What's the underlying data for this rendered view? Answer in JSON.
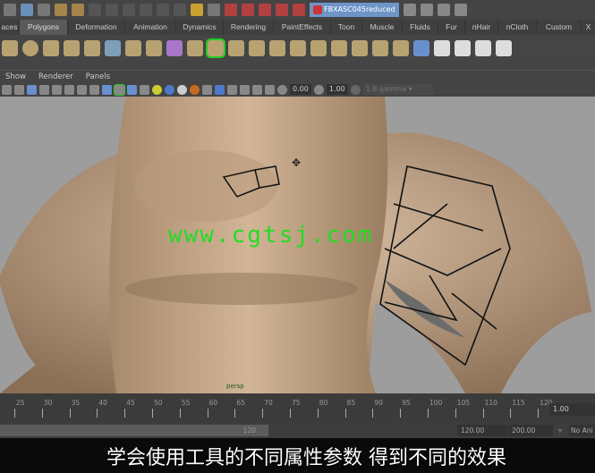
{
  "status_line": {
    "scene_field": "FBXASC045reduced"
  },
  "shelf": {
    "tabs": [
      "aces",
      "Polygons",
      "Deformation",
      "Animation",
      "Dynamics",
      "Rendering",
      "PaintEffects",
      "Toon",
      "Muscle",
      "Fluids",
      "Fur",
      "nHair",
      "nCloth",
      "Custom",
      "X"
    ],
    "active_tab": "Polygons"
  },
  "panel_menu": [
    "Show",
    "Renderer",
    "Panels"
  ],
  "panel_toolbar": {
    "exposure": "0.00",
    "gamma": "1.00",
    "color_profile": "1.8 gamma"
  },
  "viewport": {
    "camera_label": "persp",
    "watermark": "www.cgtsj.com"
  },
  "time_slider": {
    "ticks": [
      "25",
      "30",
      "35",
      "40",
      "45",
      "50",
      "55",
      "60",
      "65",
      "70",
      "75",
      "80",
      "85",
      "90",
      "95",
      "100",
      "105",
      "110",
      "115",
      "120"
    ],
    "current": "1.00"
  },
  "range_slider": {
    "range_end": "120",
    "end_time": "120.00",
    "anim_end": "200.00",
    "anim_layer": "No Ani"
  },
  "subtitle": "学会使用工具的不同属性参数 得到不同的效果",
  "colors": {
    "skin": "#c8ab8c",
    "viewport_bg": "#9d9d9d",
    "watermark": "#22dd22"
  }
}
